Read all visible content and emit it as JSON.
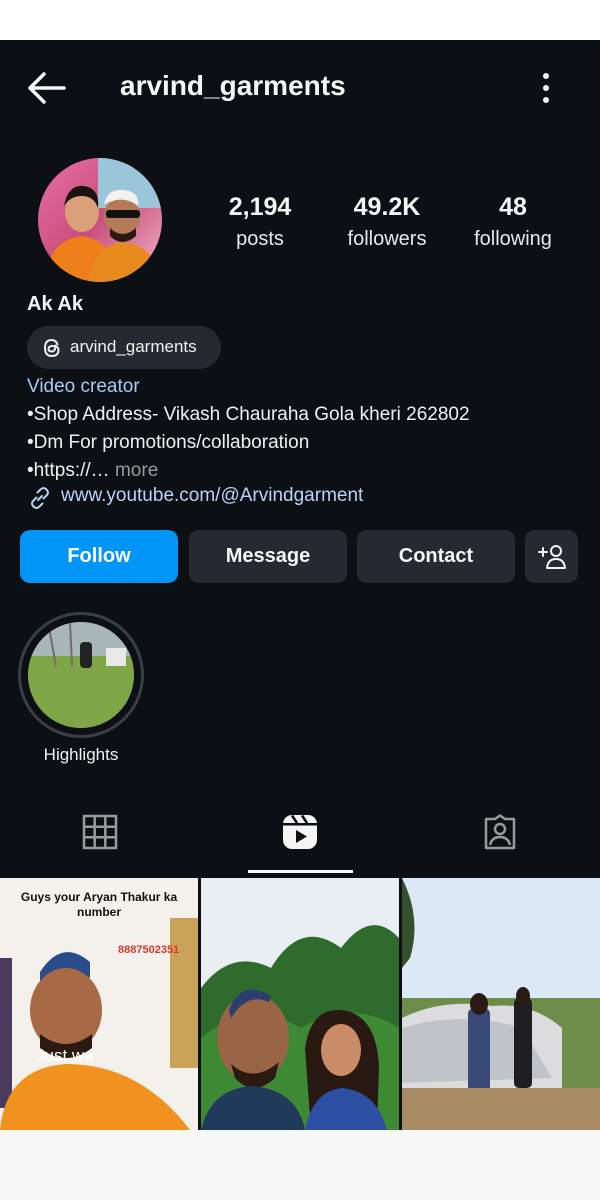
{
  "header": {
    "username": "arvind_garments",
    "back_icon": "arrow-left-icon",
    "menu_icon": "more-vertical-icon"
  },
  "profile": {
    "display_name": "Ak Ak",
    "threads_handle": "arvind_garments",
    "stats": {
      "posts": {
        "value": "2,194",
        "label": "posts"
      },
      "followers": {
        "value": "49.2K",
        "label": "followers"
      },
      "following": {
        "value": "48",
        "label": "following"
      }
    },
    "bio": {
      "category": "Video creator",
      "line1": "•Shop Address- Vikash Chauraha Gola kheri 262802",
      "line2": "•Dm For promotions/collaboration",
      "line3_prefix": "•https://…",
      "line3_more": " more",
      "link": "www.youtube.com/@Arvindgarment"
    }
  },
  "actions": {
    "follow": "Follow",
    "message": "Message",
    "contact": "Contact",
    "add_user_icon": "add-person-icon"
  },
  "highlights": [
    {
      "label": "Highlights"
    }
  ],
  "tabs": {
    "grid_icon": "grid-icon",
    "reels_icon": "reels-icon",
    "tagged_icon": "tagged-person-icon",
    "active": "reels"
  },
  "grid_posts": [
    {
      "caption": "Guys your Aryan Thakur ka number",
      "phone": "8887502351",
      "overlay": "Just wa"
    },
    {
      "caption": "",
      "overlay": ""
    },
    {
      "caption": "",
      "overlay": ""
    }
  ],
  "colors": {
    "background": "#0c1014",
    "button_primary": "#0095f6",
    "button_secondary": "#262a30",
    "link": "#b9d4f7"
  }
}
